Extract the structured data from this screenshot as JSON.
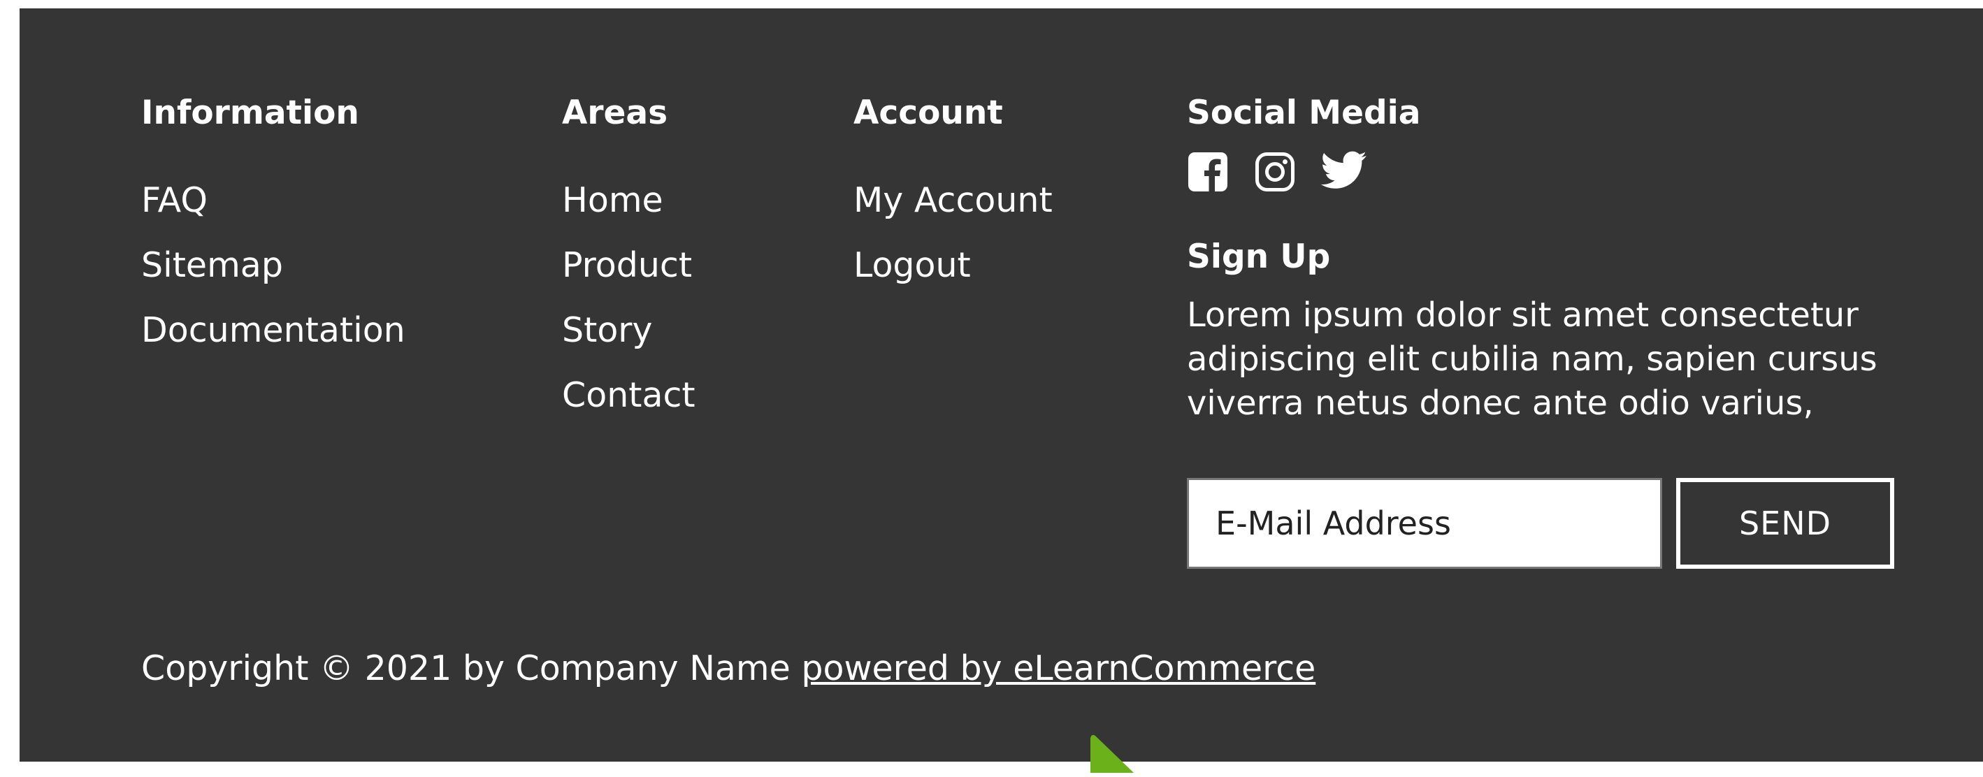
{
  "footer": {
    "information": {
      "heading": "Information",
      "links": [
        "FAQ",
        "Sitemap",
        "Documentation"
      ]
    },
    "areas": {
      "heading": "Areas",
      "links": [
        "Home",
        "Product",
        "Story",
        "Contact"
      ]
    },
    "account": {
      "heading": "Account",
      "links": [
        "My Account",
        "Logout"
      ]
    },
    "social": {
      "heading": "Social Media",
      "icons": [
        "facebook-icon",
        "instagram-icon",
        "twitter-icon"
      ]
    },
    "signup": {
      "title": "Sign Up",
      "text": "Lorem ipsum dolor sit amet consectetur adipiscing elit cubilia nam, sapien cursus viverra netus donec ante odio varius,",
      "email_placeholder": "E-Mail Address",
      "send_label": "SEND"
    },
    "copyright": {
      "text": "Copyright © 2021 by Company Name ",
      "powered_link": "powered by eLearnCommerce"
    }
  },
  "colors": {
    "footer_bg": "#353535",
    "text": "#ffffff",
    "accent_arrow": "#6bb21a"
  }
}
